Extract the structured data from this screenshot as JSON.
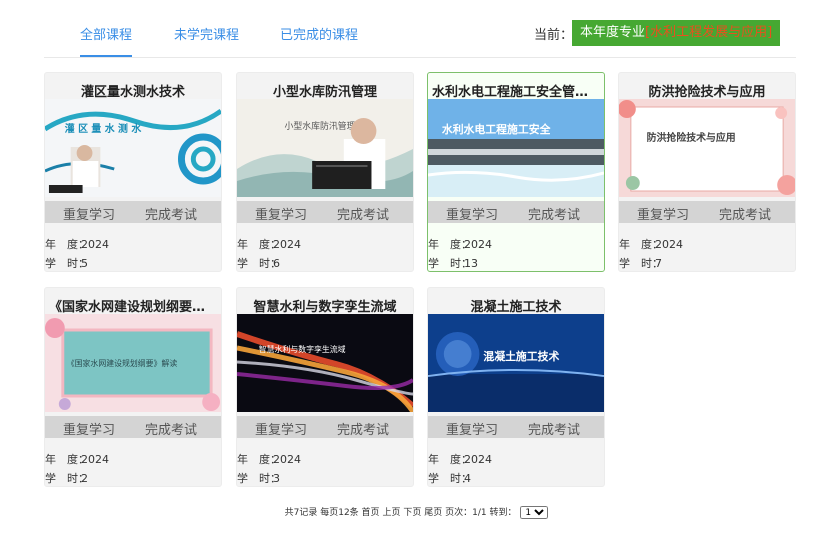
{
  "tabs": [
    {
      "label": "全部课程"
    },
    {
      "label": "未学完课程"
    },
    {
      "label": "已完成的课程"
    }
  ],
  "current": {
    "label": "当前：",
    "badge_prefix": "本年度专业",
    "badge_highlight": "[水利工程发展与应用]"
  },
  "cards": [
    {
      "title": "灌区量水测水技术",
      "thumb_text": "灌 区 量 水 测 水",
      "btn_review": "重复学习",
      "btn_exam": "完成考试",
      "year_key": "年　度：",
      "year": "2024",
      "hours_key": "学　时：",
      "hours": "5"
    },
    {
      "title": "小型水库防汛管理",
      "thumb_text": "小型水库防汛管理",
      "btn_review": "重复学习",
      "btn_exam": "完成考试",
      "year_key": "年　度：",
      "year": "2024",
      "hours_key": "学　时：",
      "hours": "6"
    },
    {
      "title": "水利水电工程施工安全管理...",
      "thumb_text": "水利水电工程施工安全",
      "btn_review": "重复学习",
      "btn_exam": "完成考试",
      "year_key": "年　度：",
      "year": "2024",
      "hours_key": "学　时：",
      "hours": "13"
    },
    {
      "title": "防洪抢险技术与应用",
      "thumb_text": "防洪抢险技术与应用",
      "btn_review": "重复学习",
      "btn_exam": "完成考试",
      "year_key": "年　度：",
      "year": "2024",
      "hours_key": "学　时：",
      "hours": "7"
    },
    {
      "title": "《国家水网建设规划纲要》...",
      "thumb_text": "《国家水网建设规划纲要》解读",
      "btn_review": "重复学习",
      "btn_exam": "完成考试",
      "year_key": "年　度：",
      "year": "2024",
      "hours_key": "学　时：",
      "hours": "2"
    },
    {
      "title": "智慧水利与数字孪生流域",
      "thumb_text": "智慧水利与数字孪生流域",
      "btn_review": "重复学习",
      "btn_exam": "完成考试",
      "year_key": "年　度：",
      "year": "2024",
      "hours_key": "学　时：",
      "hours": "3"
    },
    {
      "title": "混凝土施工技术",
      "thumb_text": "混凝土施工技术",
      "btn_review": "重复学习",
      "btn_exam": "完成考试",
      "year_key": "年　度：",
      "year": "2024",
      "hours_key": "学　时：",
      "hours": "4"
    }
  ],
  "pager": {
    "summary": "共7记录 每页12条",
    "first": "首页",
    "prev": "上页",
    "next": "下页",
    "last": "尾页",
    "page_info": "页次：1/1",
    "jump_label": "转到：",
    "jump_value": "1"
  },
  "colors": {
    "accent": "#3a8ee6",
    "badge_bg": "#46a832",
    "badge_highlight": "#e8501e",
    "active_border": "#7dc06b"
  }
}
